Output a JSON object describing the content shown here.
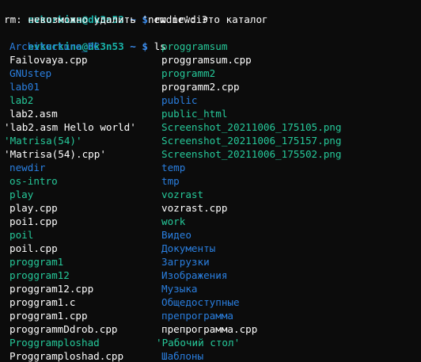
{
  "terminal": {
    "prompt_user_host": "evkurkina@dk3n53",
    "prompt_path": " ~ $ ",
    "commands": [
      {
        "text": "rm newdir"
      },
      {
        "text": "ls"
      }
    ],
    "error_output": "rm: невозможно удалить 'newdir': Это каталог",
    "ls_left": [
      {
        "name": "Architecture_PC",
        "kind": "dir"
      },
      {
        "name": "Failovaya.cpp",
        "kind": "file"
      },
      {
        "name": "GNUstep",
        "kind": "dir"
      },
      {
        "name": "lab01",
        "kind": "dir"
      },
      {
        "name": "lab2",
        "kind": "dirw"
      },
      {
        "name": "lab2.asm",
        "kind": "file"
      },
      {
        "name": "'lab2.asm Hello world'",
        "kind": "quoted"
      },
      {
        "name": "'Matrisa(54)'",
        "kind": "quoted-dirw"
      },
      {
        "name": "'Matrisa(54).cpp'",
        "kind": "quoted"
      },
      {
        "name": "newdir",
        "kind": "dir"
      },
      {
        "name": "os-intro",
        "kind": "dirw"
      },
      {
        "name": "play",
        "kind": "dirw"
      },
      {
        "name": "play.cpp",
        "kind": "file"
      },
      {
        "name": "poi1.cpp",
        "kind": "file"
      },
      {
        "name": "poil",
        "kind": "dirw"
      },
      {
        "name": "poil.cpp",
        "kind": "file"
      },
      {
        "name": "proggram1",
        "kind": "dirw"
      },
      {
        "name": "proggram12",
        "kind": "dirw"
      },
      {
        "name": "proggram12.cpp",
        "kind": "file"
      },
      {
        "name": "proggram1.c",
        "kind": "file"
      },
      {
        "name": "proggram1.cpp",
        "kind": "file"
      },
      {
        "name": "proggrammDdrob.cpp",
        "kind": "file"
      },
      {
        "name": "Proggramploshad",
        "kind": "dirw"
      },
      {
        "name": "Proggramploshad.cpp",
        "kind": "file"
      }
    ],
    "ls_right": [
      {
        "name": "proggramsum",
        "kind": "dirw"
      },
      {
        "name": "proggramsum.cpp",
        "kind": "file"
      },
      {
        "name": "programm2",
        "kind": "dirw"
      },
      {
        "name": "programm2.cpp",
        "kind": "file"
      },
      {
        "name": "public",
        "kind": "dir"
      },
      {
        "name": "public_html",
        "kind": "dirw"
      },
      {
        "name": "Screenshot_20211006_175105.png",
        "kind": "image"
      },
      {
        "name": "Screenshot_20211006_175157.png",
        "kind": "image"
      },
      {
        "name": "Screenshot_20211006_175502.png",
        "kind": "image"
      },
      {
        "name": "temp",
        "kind": "dir"
      },
      {
        "name": "tmp",
        "kind": "dir"
      },
      {
        "name": "vozrast",
        "kind": "dirw"
      },
      {
        "name": "vozrast.cpp",
        "kind": "file"
      },
      {
        "name": "work",
        "kind": "dirw"
      },
      {
        "name": "Видео",
        "kind": "dir"
      },
      {
        "name": "Документы",
        "kind": "dir"
      },
      {
        "name": "Загрузки",
        "kind": "dir"
      },
      {
        "name": "Изображения",
        "kind": "dir"
      },
      {
        "name": "Музыка",
        "kind": "dir"
      },
      {
        "name": "Общедоступные",
        "kind": "dir"
      },
      {
        "name": "препрограмма",
        "kind": "dir"
      },
      {
        "name": "препрограмма.cpp",
        "kind": "file"
      },
      {
        "name": "'Рабочий стол'",
        "kind": "quoted-dirw"
      },
      {
        "name": "Шаблоны",
        "kind": "dir"
      }
    ],
    "colors": {
      "background": "#0c0c0c",
      "prompt_user": "#18b2a8",
      "prompt_path": "#3c8ef0",
      "dir_blue": "#2a7fe0",
      "dir_green": "#26c99a",
      "image_green": "#26c99a",
      "text": "#ffffff"
    }
  }
}
